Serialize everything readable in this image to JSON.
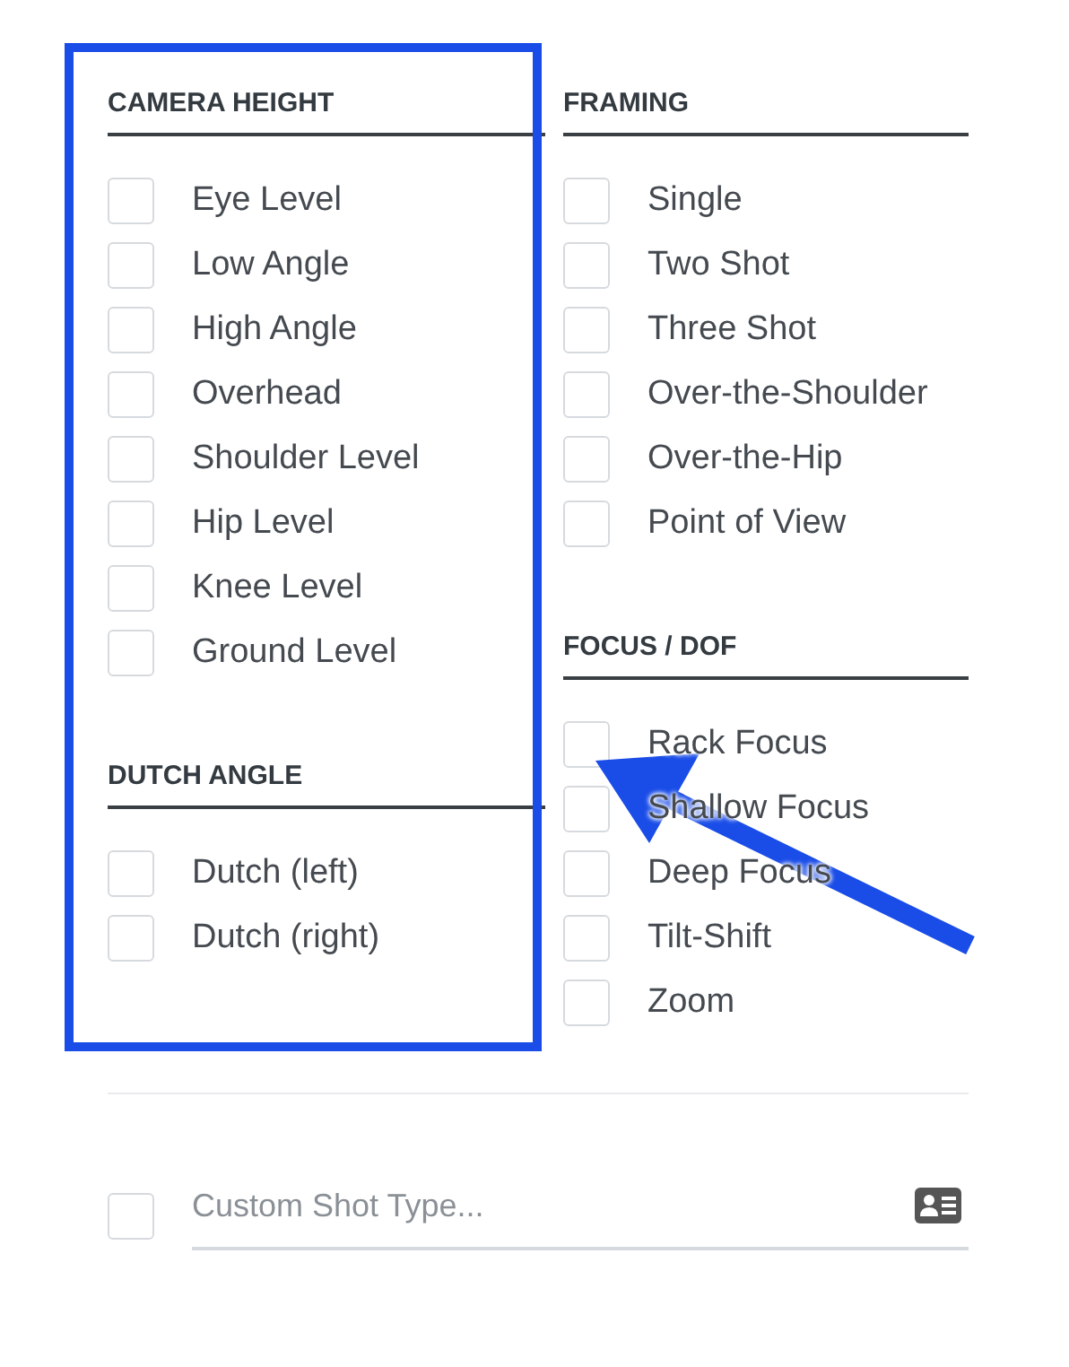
{
  "columns": [
    {
      "groups": [
        {
          "heading": "CAMERA HEIGHT",
          "options": [
            {
              "label": "Eye Level",
              "checked": false
            },
            {
              "label": "Low Angle",
              "checked": false
            },
            {
              "label": "High Angle",
              "checked": false
            },
            {
              "label": "Overhead",
              "checked": false
            },
            {
              "label": "Shoulder Level",
              "checked": false
            },
            {
              "label": "Hip Level",
              "checked": false
            },
            {
              "label": "Knee Level",
              "checked": false
            },
            {
              "label": "Ground Level",
              "checked": false
            }
          ]
        },
        {
          "heading": "DUTCH ANGLE",
          "options": [
            {
              "label": "Dutch (left)",
              "checked": false
            },
            {
              "label": "Dutch (right)",
              "checked": false
            }
          ]
        }
      ]
    },
    {
      "groups": [
        {
          "heading": "FRAMING",
          "options": [
            {
              "label": "Single",
              "checked": false
            },
            {
              "label": "Two Shot",
              "checked": false
            },
            {
              "label": "Three Shot",
              "checked": false
            },
            {
              "label": "Over-the-Shoulder",
              "checked": false
            },
            {
              "label": "Over-the-Hip",
              "checked": false
            },
            {
              "label": "Point of View",
              "checked": false
            }
          ]
        },
        {
          "heading": "FOCUS / DOF",
          "options": [
            {
              "label": "Rack Focus",
              "checked": false
            },
            {
              "label": "Shallow Focus",
              "checked": false
            },
            {
              "label": "Deep Focus",
              "checked": false
            },
            {
              "label": "Tilt-Shift",
              "checked": false
            },
            {
              "label": "Zoom",
              "checked": false
            }
          ]
        }
      ]
    }
  ],
  "custom": {
    "checked": false,
    "placeholder": "Custom Shot Type..."
  },
  "highlight": {
    "color": "#1a4de8"
  },
  "arrow": {
    "color": "#1a4de8"
  }
}
